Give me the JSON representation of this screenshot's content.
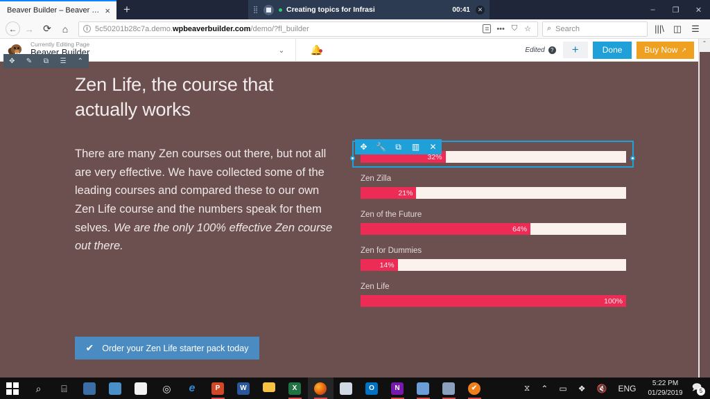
{
  "browser": {
    "tab": {
      "title": "Beaver Builder – Beaver Builder",
      "close_label": "×"
    },
    "new_tab_label": "+",
    "window_controls": {
      "minimize": "–",
      "maximize": "❐",
      "close": "✕"
    },
    "toast": {
      "title": "Creating topics for Infrasi",
      "time": "00:41",
      "close_label": "✕",
      "status_color": "#2ecc71",
      "background": "#2d3b52"
    },
    "nav": {
      "back": "←",
      "forward": "→",
      "reload": "⟳",
      "home": "⌂",
      "info_icon": "i",
      "url_prefix": "5c50201b28c7a.demo.",
      "url_bold": "wpbeaverbuilder.com",
      "url_suffix": "/demo/?fl_builder",
      "reader_icon": "☰",
      "menu_dots": "•••",
      "pocket_icon": "♥",
      "star_icon": "☆",
      "search_placeholder": "Search",
      "search_icon": "⚲",
      "library_icon": "|||\\",
      "sidebar_icon": "◫",
      "hamburger_icon": "☰"
    }
  },
  "admin_bar": {
    "logo_name": "beaver-logo",
    "subtitle": "Currently Editing Page",
    "title": "Beaver Builder",
    "caret": "⌄",
    "bell_icon": "ὑ4",
    "edited_label": "Edited",
    "help_label": "?",
    "add_label": "+",
    "done_label": "Done",
    "buy_label": "Buy Now",
    "external_icon": "↗",
    "colors": {
      "done": "#1fa0d8",
      "buy": "#f0a021"
    }
  },
  "row_toolbar": {
    "items": [
      {
        "name": "move-icon",
        "glyph": "✥"
      },
      {
        "name": "edit-icon",
        "glyph": "✎"
      },
      {
        "name": "duplicate-icon",
        "glyph": "⧉"
      },
      {
        "name": "columns-icon",
        "glyph": "☰"
      },
      {
        "name": "collapse-icon",
        "glyph": "⌃"
      }
    ]
  },
  "page": {
    "background": "#6c4f4f",
    "heading": "Zen Life, the course that actually works",
    "paragraph_plain": "There are many Zen courses out there, but not all are very effective. We have collected some of the leading courses and compared these to our own Zen Life course and the numbers speak for them selves. ",
    "paragraph_italic": "We are the only 100% effective Zen course out there.",
    "cta": {
      "label": "Order your Zen Life starter pack today",
      "check_icon": "✔",
      "color": "#4a8bc2"
    }
  },
  "chart_data": {
    "type": "bar",
    "title": "",
    "orientation": "horizontal",
    "categories": [
      "",
      "Zen Zilla",
      "Zen of the Future",
      "Zen for Dummies",
      "Zen Life"
    ],
    "values": [
      32,
      21,
      64,
      14,
      100
    ],
    "value_labels": [
      "32%",
      "21%",
      "64%",
      "14%",
      "100%"
    ],
    "xlim": [
      0,
      100
    ],
    "ylabel": "",
    "xlabel": "",
    "grid": false,
    "legend": "none",
    "fill_color": "#ec2c55",
    "track_color": "#fbf2ee",
    "label_color": "#e3d8d8"
  },
  "selection": {
    "outline_color": "#1fa0d8",
    "toolbar": [
      {
        "name": "move-module-icon",
        "glyph": "✥"
      },
      {
        "name": "settings-wrench-icon",
        "glyph": "ὒ7"
      },
      {
        "name": "duplicate-module-icon",
        "glyph": "⧉"
      },
      {
        "name": "column-settings-icon",
        "glyph": "▥"
      },
      {
        "name": "remove-module-icon",
        "glyph": "✕"
      }
    ]
  },
  "taskbar": {
    "items": [
      {
        "name": "start-button",
        "glyph": "",
        "kind": "start",
        "running": false
      },
      {
        "name": "search-icon",
        "glyph": "⌕",
        "kind": "glyph",
        "running": false
      },
      {
        "name": "task-view-icon",
        "glyph": "⌸",
        "kind": "glyph",
        "running": false
      },
      {
        "name": "remote-desktop-icon",
        "glyph": "Ὓ3",
        "kind": "img",
        "color": "#3b6ea5",
        "running": false
      },
      {
        "name": "screen-snip-icon",
        "glyph": "⬚",
        "kind": "img",
        "color": "#4a90c8",
        "running": false
      },
      {
        "name": "microsoft-store-icon",
        "glyph": "Ὤd",
        "kind": "img",
        "color": "#f2f2f2",
        "running": false
      },
      {
        "name": "camtasia-icon",
        "glyph": "◎",
        "kind": "glyph",
        "running": false
      },
      {
        "name": "edge-icon",
        "glyph": "e",
        "kind": "edge",
        "running": false
      },
      {
        "name": "powerpoint-icon",
        "glyph": "P",
        "kind": "office",
        "color": "#d24726",
        "running": true
      },
      {
        "name": "word-icon",
        "glyph": "W",
        "kind": "office",
        "color": "#2b579a",
        "running": false
      },
      {
        "name": "file-explorer-icon",
        "glyph": "὜0",
        "kind": "folder",
        "color": "#f5c243",
        "running": false
      },
      {
        "name": "excel-icon",
        "glyph": "X",
        "kind": "office",
        "color": "#217346",
        "running": true
      },
      {
        "name": "firefox-icon",
        "glyph": "ᾘa",
        "kind": "firefox",
        "color": "#e66000",
        "running": true,
        "active": true
      },
      {
        "name": "paint-icon",
        "glyph": "Ἲ8",
        "kind": "img",
        "color": "#cfd8e3",
        "running": false
      },
      {
        "name": "outlook-icon",
        "glyph": "O",
        "kind": "office",
        "color": "#0072c6",
        "running": false
      },
      {
        "name": "onenote-icon",
        "glyph": "N",
        "kind": "office",
        "color": "#7719aa",
        "running": true
      },
      {
        "name": "sticky-notes-icon",
        "glyph": "Ὕ2",
        "kind": "img",
        "color": "#6b9ed6",
        "running": true
      },
      {
        "name": "snipping-tool-icon",
        "glyph": "✂",
        "kind": "img",
        "color": "#8aa0bd",
        "running": true
      },
      {
        "name": "todoist-icon",
        "glyph": "✔",
        "kind": "circle",
        "color": "#ef7f1a",
        "running": true
      }
    ],
    "tray": [
      {
        "name": "people-icon",
        "glyph": "὆4"
      },
      {
        "name": "show-hidden-icons-chevron",
        "glyph": "⌃"
      },
      {
        "name": "battery-icon",
        "glyph": "ὐb"
      },
      {
        "name": "dropbox-icon",
        "glyph": "❖"
      },
      {
        "name": "volume-muted-icon",
        "glyph": "ὐ7"
      }
    ],
    "language": "ENG",
    "clock_time": "5:22 PM",
    "clock_date": "01/29/2019",
    "notification_icon": "὚8",
    "notification_count": "5"
  }
}
